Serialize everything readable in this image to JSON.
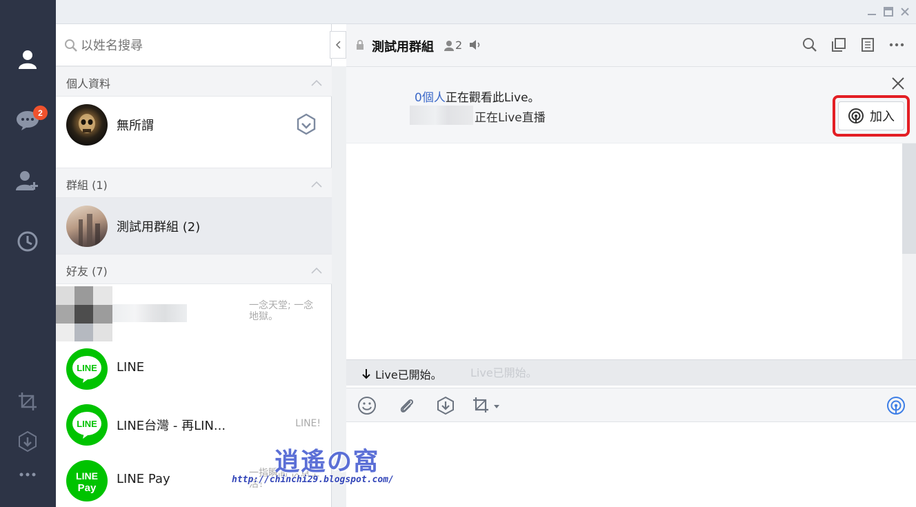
{
  "nav": {
    "items": [
      "friends-icon",
      "chats-icon",
      "add-friend-icon",
      "timeline-icon",
      "screenshot-icon",
      "download-icon",
      "more-icon"
    ],
    "chat_badge": "2"
  },
  "search": {
    "placeholder": "以姓名搜尋"
  },
  "sections": {
    "profile": "個人資料",
    "groups": "群組 (1)",
    "friends": "好友 (7)"
  },
  "profile": {
    "name": "無所謂"
  },
  "group": {
    "name": "測試用群組 (2)"
  },
  "friends": [
    {
      "name": "",
      "status": "一念天堂; 一念地獄。"
    },
    {
      "name": "LINE",
      "status": ""
    },
    {
      "name": "LINE台灣 - 再LIN...",
      "status": "LINE!"
    },
    {
      "name": "LINE Pay",
      "status": "一指瞬間 快意生活！"
    }
  ],
  "chat": {
    "title": "測試用群組",
    "member_count": "2",
    "live_viewers_highlight": "0個人",
    "live_viewers_text": "正在觀看此Live。",
    "live_status": "正在Live直播",
    "join_label": "加入",
    "notice": "Live已開始。",
    "notice_ghost": "Live已開始。"
  },
  "watermark": {
    "title": "逍遙の窩",
    "url": "http://chinchi29.blogspot.com/"
  },
  "colors": {
    "nav_bg": "#2d3446",
    "badge": "#f0522d",
    "line_green": "#00c300",
    "highlight_blue": "#3d6ac9",
    "join_outline": "#e31e24"
  }
}
